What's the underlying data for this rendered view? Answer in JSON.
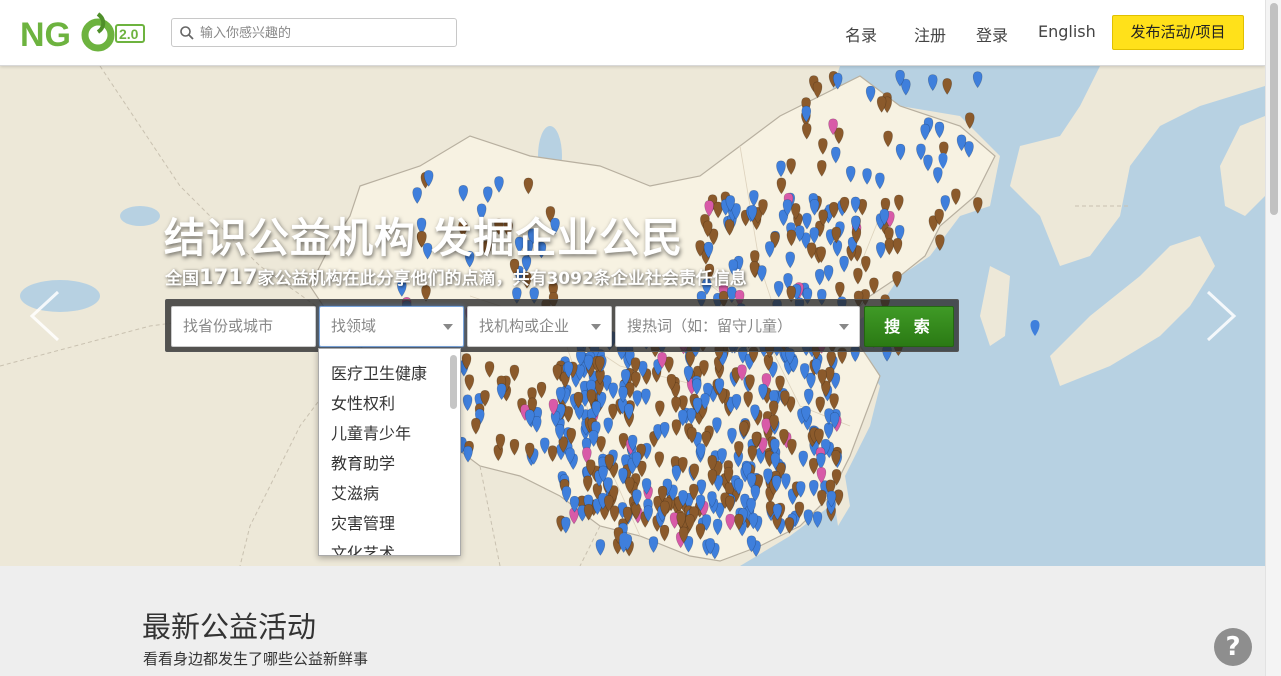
{
  "header": {
    "logo": {
      "text": "NG",
      "badge": "2.0",
      "colors": {
        "green": "#6db33f",
        "dark_green": "#4f8f2a"
      }
    },
    "search": {
      "placeholder": "输入你感兴趣的",
      "value": ""
    },
    "nav": [
      {
        "label": "名录"
      },
      {
        "label": "注册"
      },
      {
        "label": "登录"
      },
      {
        "label": "English"
      }
    ],
    "publish_label": "发布活动/项目"
  },
  "hero": {
    "title": "结识公益机构 发掘企业公民",
    "subtitle_prefix": "全国",
    "org_count": "1717",
    "subtitle_middle": "家公益机构在此分享他们的点滴，共有",
    "csr_count": "3092",
    "subtitle_suffix": "条企业社会责任信息",
    "map_colors": {
      "water": "#b7d1e2",
      "land": "#ede8d8",
      "china": "#f7f2e2",
      "pin_brown": "#8b5a2b",
      "pin_blue": "#3f7fdc",
      "pin_pink": "#d85aa8"
    }
  },
  "search_panel": {
    "province_placeholder": "找省份或城市",
    "domain_placeholder": "找领域",
    "org_placeholder": "找机构或企业",
    "keyword_placeholder": "搜热词（如：留守儿童）",
    "search_label": "搜 索"
  },
  "dropdown": {
    "options": [
      "医疗卫生健康",
      "女性权利",
      "儿童青少年",
      "教育助学",
      "艾滋病",
      "灾害管理",
      "文化艺术"
    ]
  },
  "latest": {
    "title": "最新公益活动",
    "subtitle": "看看身边都发生了哪些公益新鲜事"
  },
  "help_label": "?"
}
